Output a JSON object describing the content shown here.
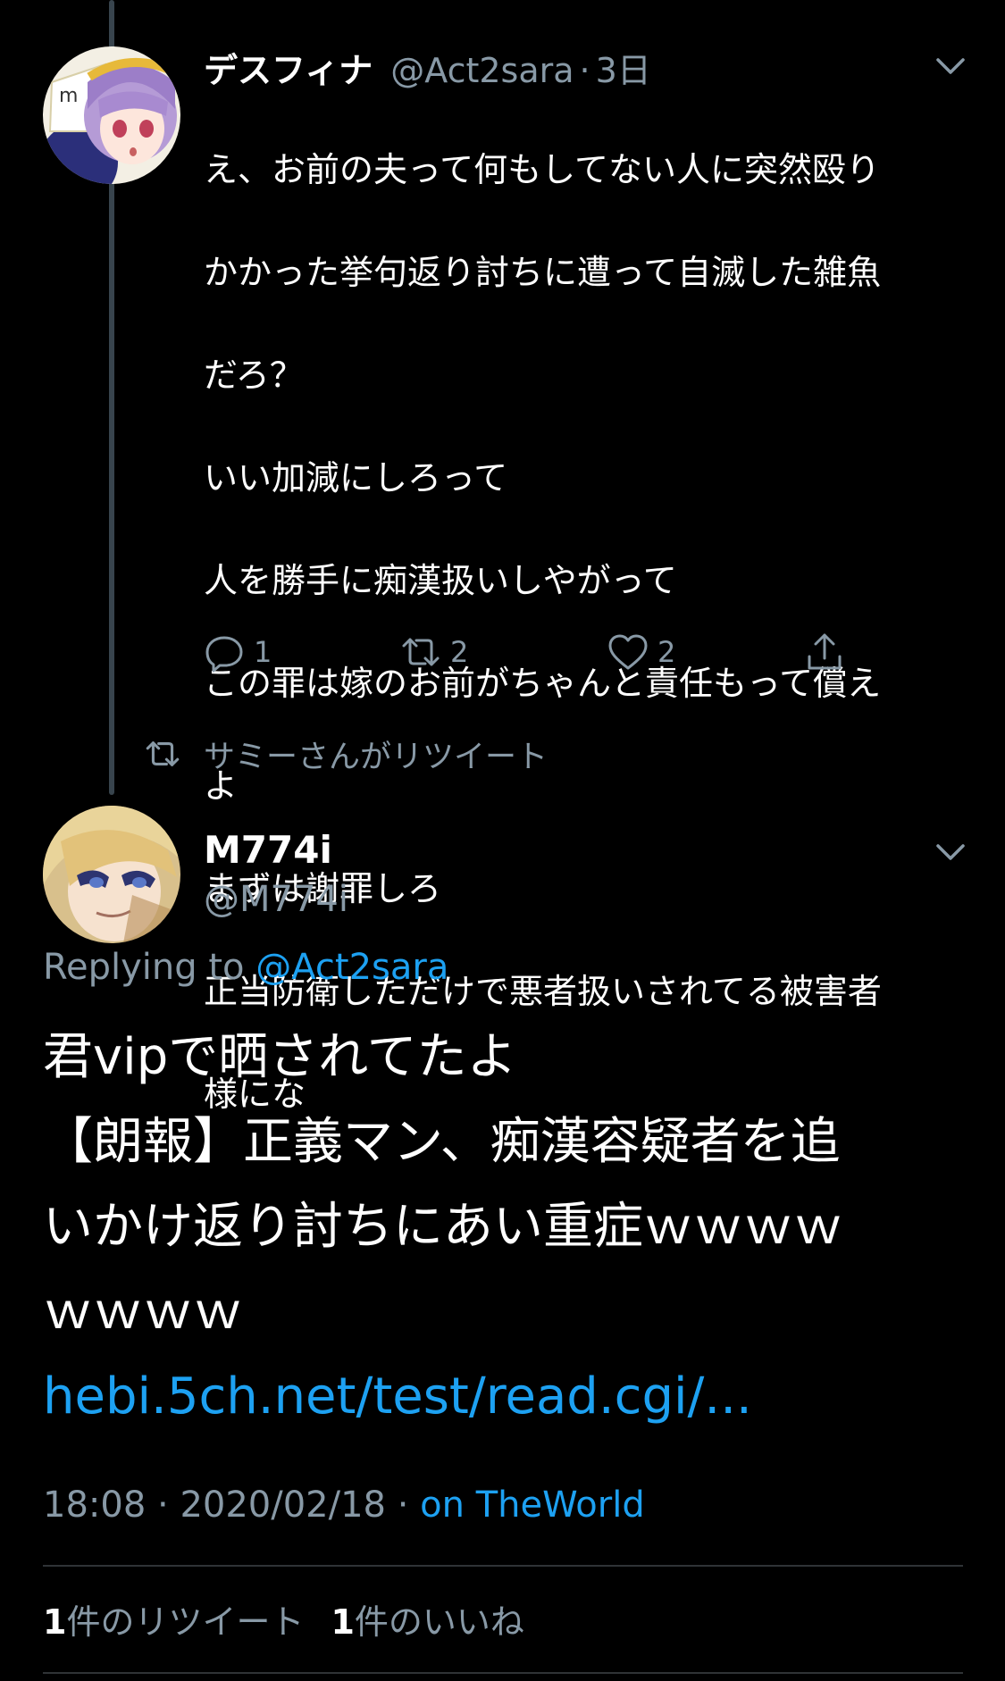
{
  "tweet1": {
    "display_name": "デスフィナ",
    "handle": "@Act2sara",
    "separator": "·",
    "time": "3日",
    "text_lines": [
      "え、お前の夫って何もしてない人に突然殴り",
      "かかった挙句返り討ちに遭って自滅した雑魚",
      "だろ？",
      "いい加減にしろって",
      "人を勝手に痴漢扱いしやがって",
      "この罪は嫁のお前がちゃんと責任もって償え",
      "よ",
      "まずは謝罪しろ",
      "正当防衛しただけで悪者扱いされてる被害者",
      "様にな"
    ],
    "reply_count": "1",
    "retweet_count": "2",
    "like_count": "2",
    "icons": {
      "reply": "reply-icon",
      "retweet": "retweet-icon",
      "like": "heart-icon",
      "share": "share-icon",
      "more": "chevron-down-icon"
    }
  },
  "retweet_context": {
    "text": "サミーさんがリツイート",
    "icon": "retweet-icon"
  },
  "tweet2": {
    "display_name": "M774i",
    "handle": "@M774i",
    "replying_prefix": "Replying to",
    "replying_handle": "@Act2sara",
    "text_lines": [
      "君vipで晒されてたよ",
      "【朗報】正義マン、痴漢容疑者を追",
      "いかけ返り討ちにあい重症ｗｗｗｗ",
      "ｗｗｗｗ"
    ],
    "link": "hebi.5ch.net/test/read.cgi/...",
    "time": "18:08",
    "separator": "·",
    "date": "2020/02/18",
    "source_prefix": "on",
    "source": "TheWorld",
    "retweets_count": "1",
    "retweets_label": "件のリツイート",
    "likes_count": "1",
    "likes_label": "件のいいね"
  },
  "colors": {
    "background": "#000000",
    "primary_text": "#ffffff",
    "secondary_text": "#8899a6",
    "link": "#1da1f2",
    "thread_line": "#38444d",
    "divider": "#2f3336"
  }
}
